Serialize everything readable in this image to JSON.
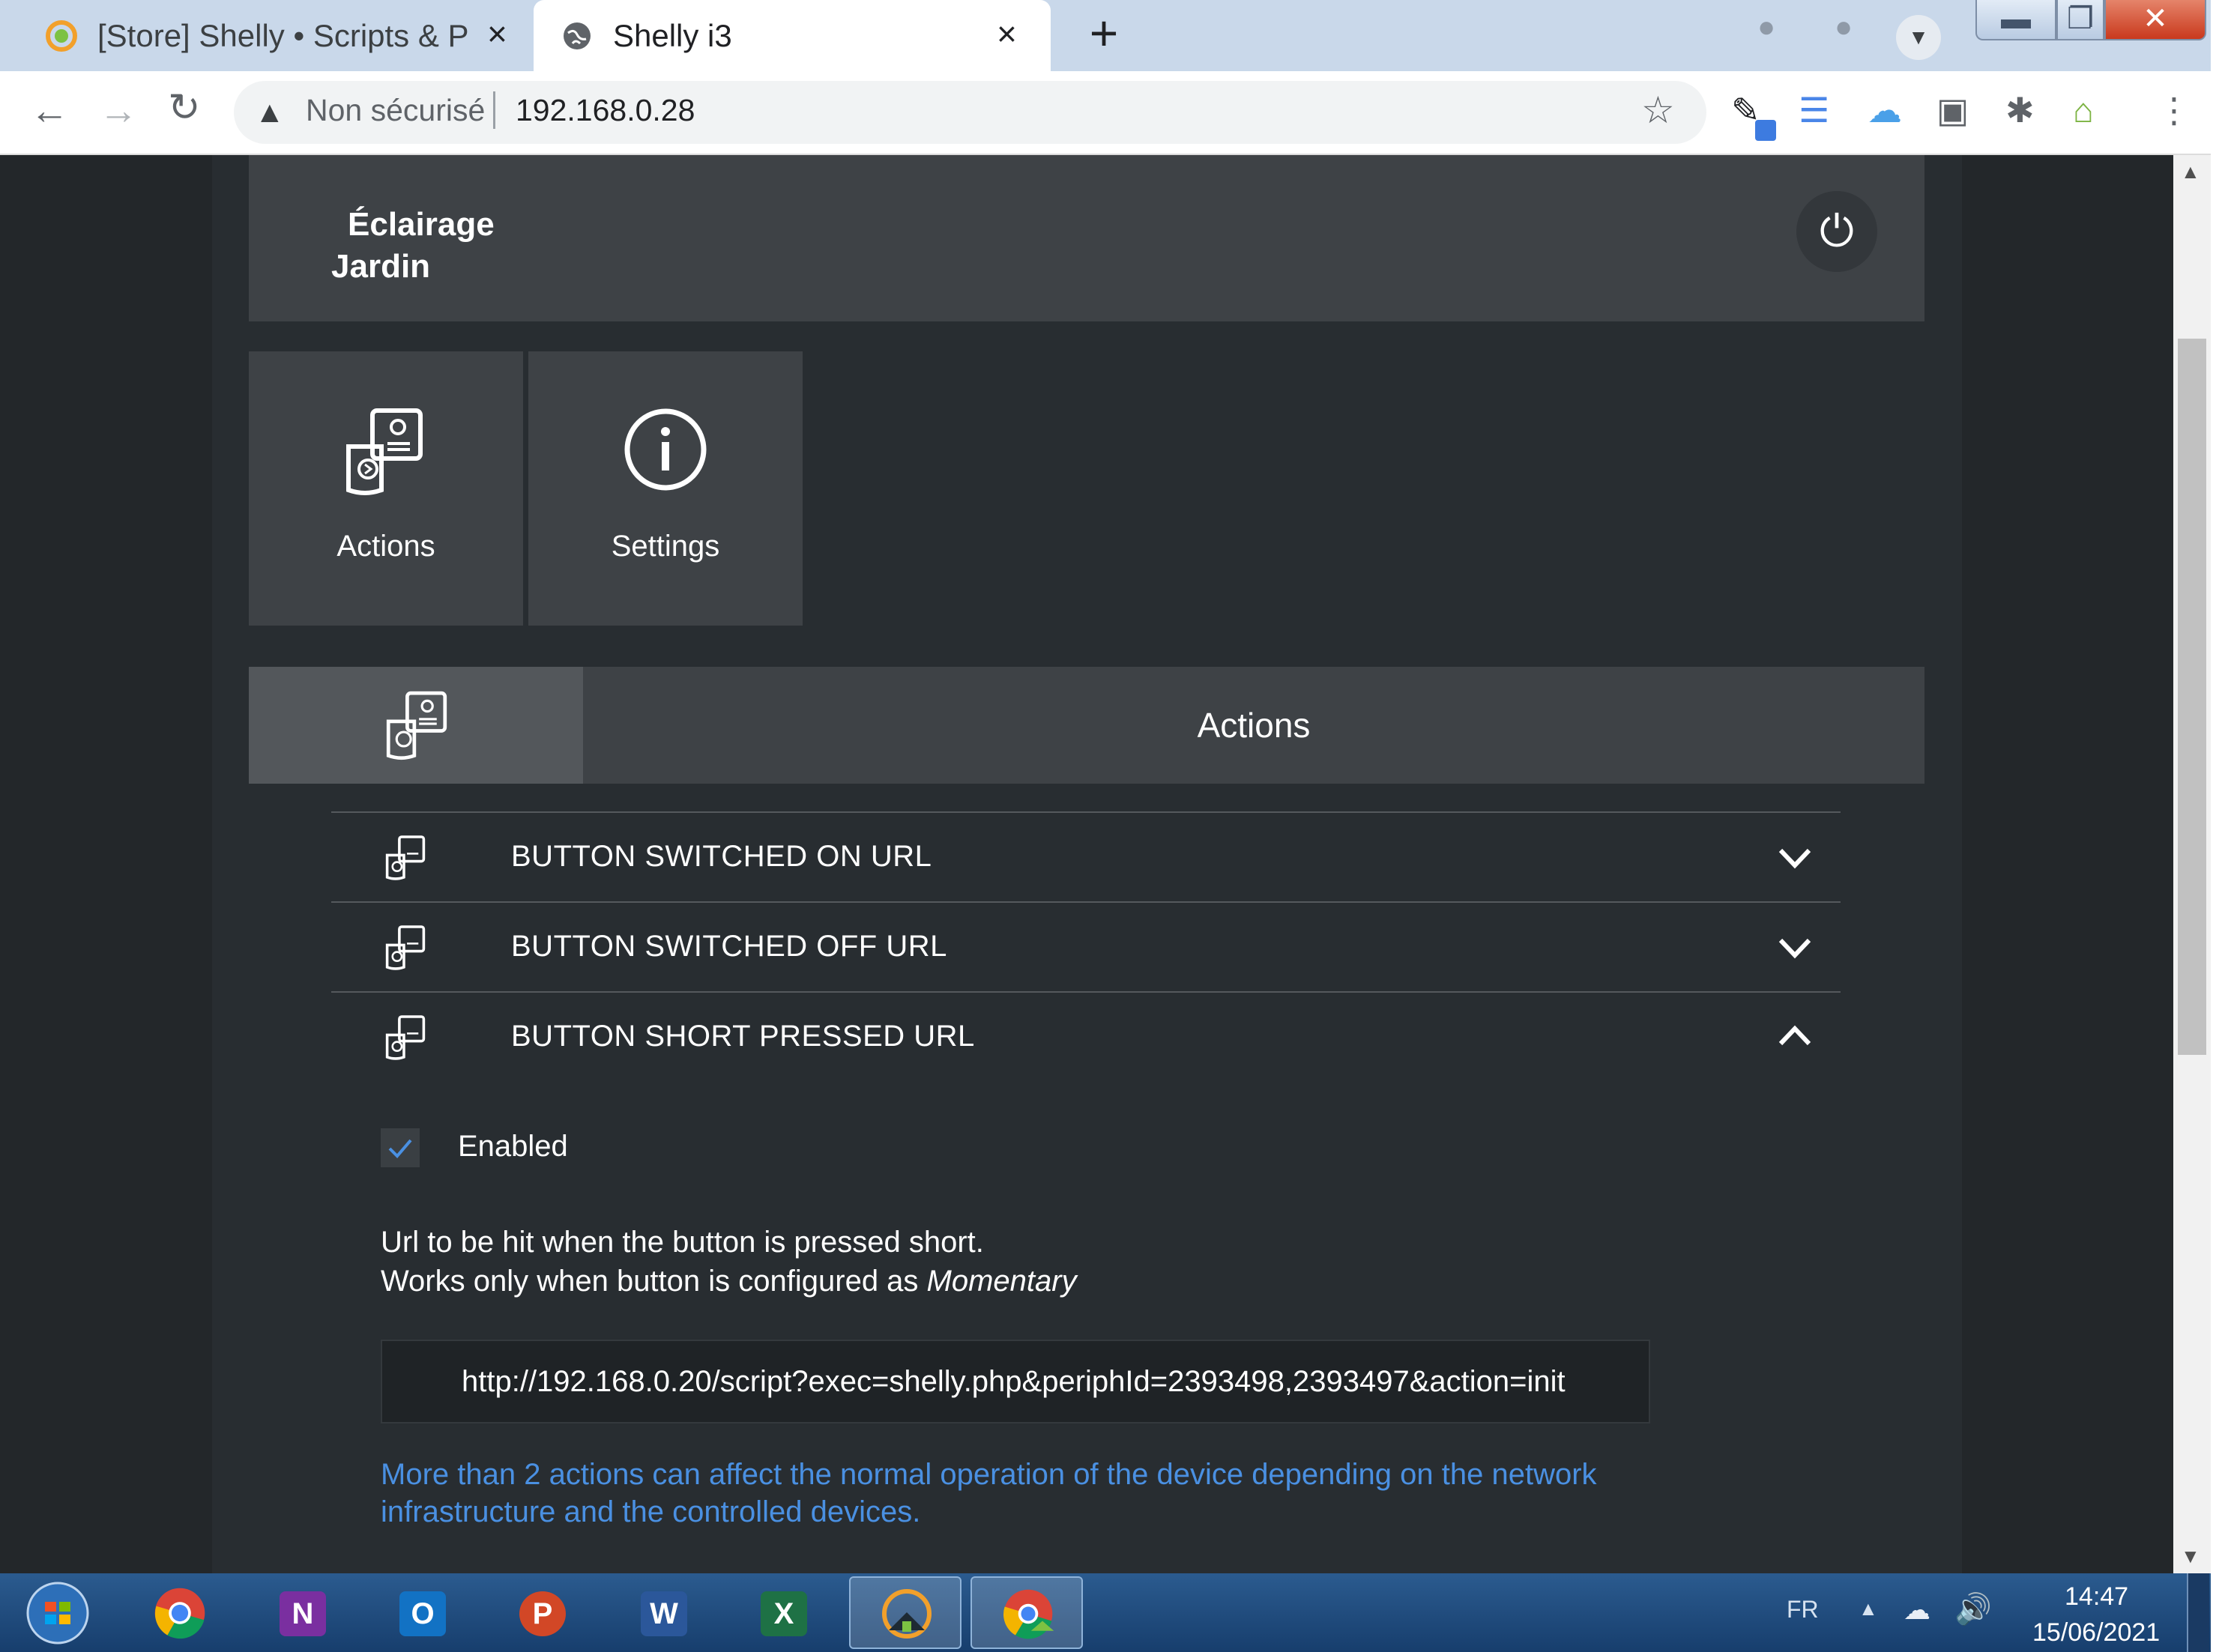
{
  "browser": {
    "tabs": [
      {
        "title": "[Store] Shelly • Scripts & P",
        "active": false
      },
      {
        "title": "Shelly i3",
        "active": true
      }
    ],
    "close_glyph": "×",
    "new_tab_glyph": "+",
    "address": {
      "security_label": "Non sécurisé",
      "url": "192.168.0.28"
    }
  },
  "device": {
    "name_line1": "Éclairage",
    "name_line2": "Jardin"
  },
  "tiles": [
    {
      "label": "Actions",
      "icon": "actions-icon"
    },
    {
      "label": "Settings",
      "icon": "info-icon"
    }
  ],
  "section": {
    "title": "Actions"
  },
  "action_rows": [
    {
      "label": "BUTTON SWITCHED ON URL",
      "expanded": false
    },
    {
      "label": "BUTTON SWITCHED OFF URL",
      "expanded": false
    },
    {
      "label": "BUTTON SHORT PRESSED URL",
      "expanded": true
    }
  ],
  "expanded_panel": {
    "enabled_label": "Enabled",
    "enabled_checked": true,
    "description_line1": "Url to be hit when the button is pressed short.",
    "description_line2_prefix": "Works only when button is configured as ",
    "description_line2_emphasis": "Momentary",
    "url_value": "http://192.168.0.20/script?exec=shelly.php&periphId=2393498,2393497&action=init",
    "warning_line1": "More than 2 actions can affect the normal operation of the device depending on the network",
    "warning_line2": "infrastructure and the controlled devices."
  },
  "taskbar": {
    "apps": [
      "start-orb",
      "chrome",
      "onenote",
      "outlook",
      "powerpoint",
      "word",
      "excel",
      "jeedom-app",
      "chrome-jeedom"
    ],
    "app_letters": {
      "onenote": "N",
      "outlook": "O",
      "powerpoint": "P",
      "word": "W",
      "excel": "X"
    },
    "language": "FR",
    "time": "14:47",
    "date": "15/06/2021"
  },
  "colors": {
    "page_bg": "#23272a",
    "card_bg": "#3e4246",
    "link_blue": "#4a90e2",
    "check_blue": "#4a90e2"
  }
}
